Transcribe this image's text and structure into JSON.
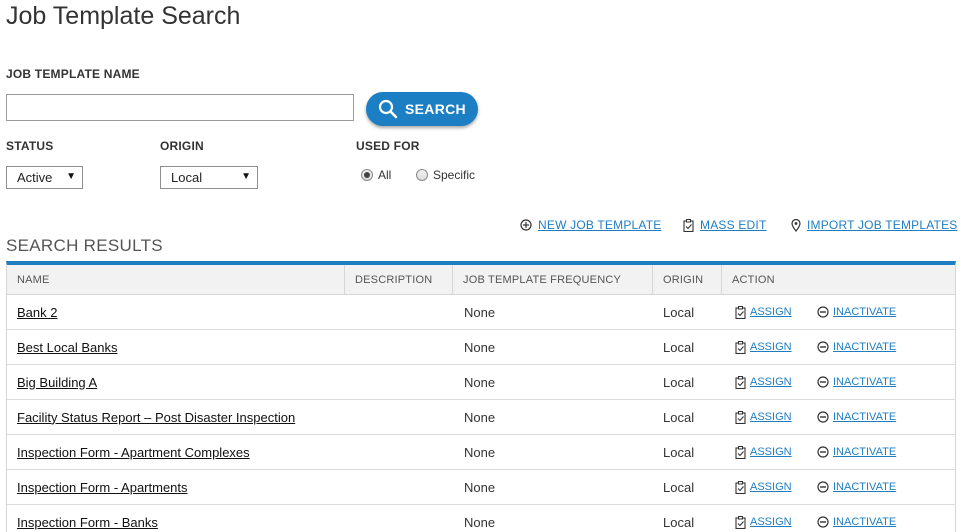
{
  "page": {
    "title": "Job Template Search"
  },
  "form": {
    "name_label": "JOB TEMPLATE NAME",
    "name_value": "",
    "search_label": "SEARCH",
    "status_label": "STATUS",
    "status_value": "Active",
    "origin_label": "ORIGIN",
    "origin_value": "Local",
    "used_for_label": "USED FOR",
    "used_for_options": [
      "All",
      "Specific"
    ],
    "used_for_selected": "All"
  },
  "actions": {
    "new_template": "NEW JOB TEMPLATE",
    "mass_edit": "MASS EDIT",
    "import_templates": "IMPORT JOB TEMPLATES"
  },
  "results": {
    "title": "SEARCH RESULTS",
    "columns": [
      "NAME",
      "DESCRIPTION",
      "JOB TEMPLATE FREQUENCY",
      "ORIGIN",
      "ACTION"
    ],
    "assign_label": "ASSIGN",
    "inactivate_label": "INACTIVATE",
    "rows": [
      {
        "name": "Bank 2",
        "description": "",
        "frequency": "None",
        "origin": "Local"
      },
      {
        "name": "Best Local Banks",
        "description": "",
        "frequency": "None",
        "origin": "Local"
      },
      {
        "name": "Big Building A",
        "description": "",
        "frequency": "None",
        "origin": "Local"
      },
      {
        "name": "Facility Status Report – Post Disaster Inspection",
        "description": "",
        "frequency": "None",
        "origin": "Local"
      },
      {
        "name": "Inspection Form - Apartment Complexes",
        "description": "",
        "frequency": "None",
        "origin": "Local"
      },
      {
        "name": "Inspection Form - Apartments",
        "description": "",
        "frequency": "None",
        "origin": "Local"
      },
      {
        "name": "Inspection Form - Banks",
        "description": "",
        "frequency": "None",
        "origin": "Local"
      }
    ]
  },
  "colors": {
    "accent": "#1f7ec1",
    "button": "#1c7fc4"
  }
}
